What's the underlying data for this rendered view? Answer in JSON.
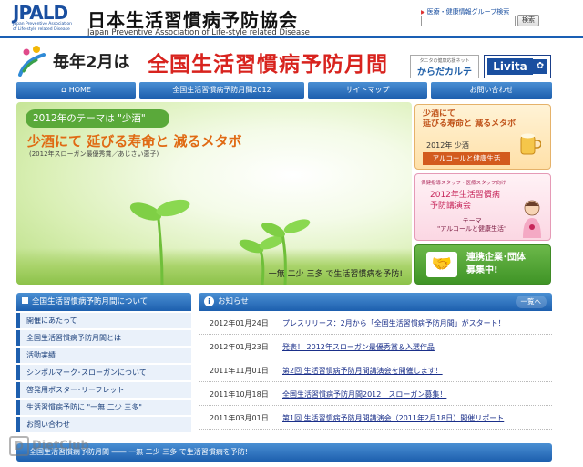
{
  "header": {
    "logo_mark": "JPALD",
    "logo_sub": [
      "Japan Preventive Association",
      "of Life-style related Disease"
    ],
    "title": "日本生活習慣病予防協会",
    "title_en": "Japan Preventive Association of Life-style related Disease",
    "search_label": "医療・健康情報グループ検索",
    "search_placeholder": "",
    "search_button": "検索"
  },
  "banner": {
    "prefix": "毎年2月は",
    "title": "全国生活習慣病予防月間",
    "partner1_small": "タニタの健康応援ネット",
    "partner1_text": "からだカルテ",
    "partner2_text": "Livita"
  },
  "nav": {
    "items": [
      "HOME",
      "全国生活習慣病予防月間2012",
      "サイトマップ",
      "お問い合わせ"
    ]
  },
  "hero": {
    "theme": "2012年のテーマは \"少酒\"",
    "slogan": "少酒にて 延びる寿命と 減るメタボ",
    "credit": "(2012年スローガン最優秀賞／あじさい恵子)",
    "caption": "一無 二少 三多 で生活習慣病を予防!"
  },
  "side": {
    "panel1": {
      "title_line1": "少酒にて",
      "title_line2": "延びる寿命と 減るメタボ",
      "year": "2012年 少酒",
      "tag": "アルコールと健康生活"
    },
    "panel2": {
      "small": "保健指導スタッフ・医療スタッフ向け",
      "title_line1": "2012年生活習慣病",
      "title_line2": "予防講演会",
      "theme_label": "テーマ",
      "theme": "\"アルコールと健康生活\""
    },
    "panel3": {
      "line1": "連携企業･団体",
      "line2": "募集中!"
    }
  },
  "left_menu": {
    "header": "全国生活習慣病予防月間について",
    "items": [
      "開催にあたって",
      "全国生活習慣病予防月間とは",
      "活動実績",
      "シンボルマーク･スローガンについて",
      "啓発用ポスター･リーフレット",
      "生活習慣病予防に \"一無 二少 三多\"",
      "お問い合わせ"
    ]
  },
  "news": {
    "header": "お知らせ",
    "more": "一覧へ",
    "items": [
      {
        "date": "2012年01月24日",
        "title": "プレスリリース：2月から「全国生活習慣病予防月間」がスタート！"
      },
      {
        "date": "2012年01月23日",
        "title": "発表！ 2012年スローガン最優秀賞＆入選作品"
      },
      {
        "date": "2011年11月01日",
        "title": "第2回 生活習慣病予防月間講演会を開催します！"
      },
      {
        "date": "2011年10月18日",
        "title": "全国生活習慣病予防月間2012　スローガン募集！"
      },
      {
        "date": "2011年03月01日",
        "title": "第1回 生活習慣病予防月間講演会（2011年2月18日）開催リポート"
      }
    ]
  },
  "footer": {
    "text": "全国生活習慣病予防月間 ―― 一無 二少 三多 で生活習慣病を予防!"
  },
  "watermark": "DietClub"
}
